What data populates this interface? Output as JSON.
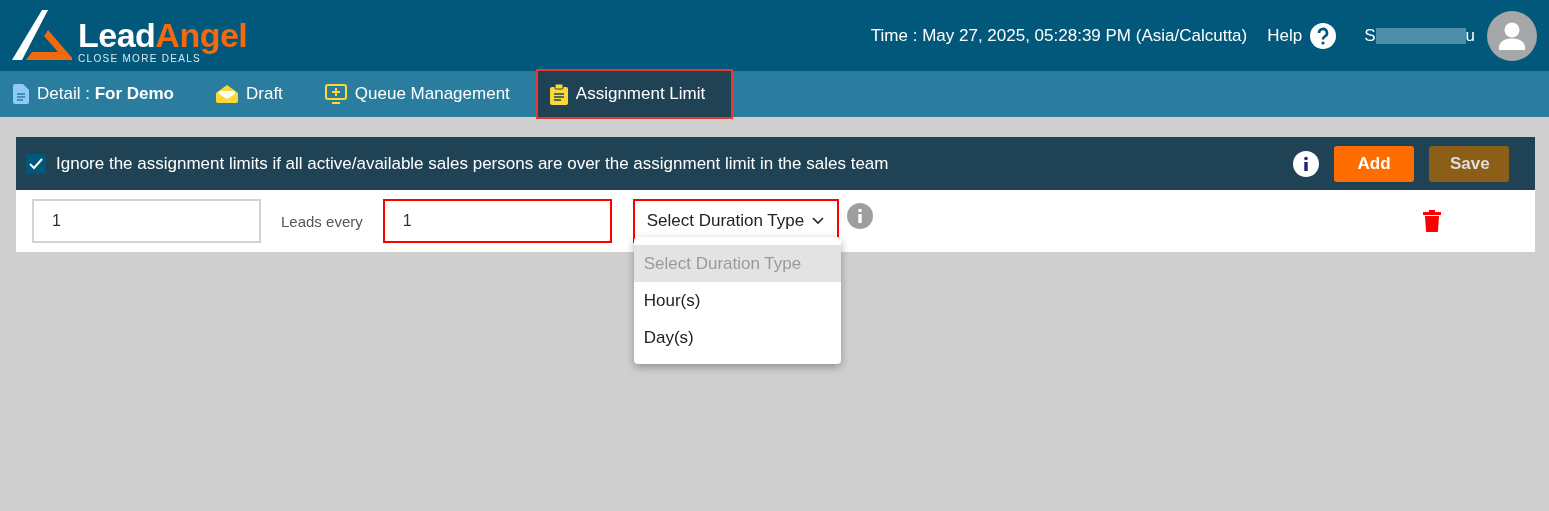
{
  "logo": {
    "part_1": "Lead",
    "part_2": "Angel",
    "tagline": "CLOSE MORE DEALS"
  },
  "header": {
    "time": "Time : May 27, 2025, 05:28:39 PM (Asia/Calcutta)",
    "help": "Help",
    "user_start": "S",
    "user_end": "u"
  },
  "tabs": [
    {
      "label": "Detail : **For Demo**",
      "selected": false
    },
    {
      "label": "Draft",
      "selected": false
    },
    {
      "label": "Queue Management",
      "selected": false
    },
    {
      "label": "Assignment Limit",
      "selected": true
    }
  ],
  "options_bar": {
    "checked": true,
    "text": "Ignore the assignment limits if all active/available sales persons are over the assignment limit in the sales team",
    "buttons": [
      {
        "label": "Add",
        "kind": "primary"
      },
      {
        "label": "Save",
        "kind": "secondary"
      }
    ]
  },
  "limit_row": {
    "count": {
      "value": "1",
      "invalid": false
    },
    "label": "Leads every",
    "period": {
      "value": "1",
      "invalid": true
    },
    "duration": {
      "value": "Select Duration Type",
      "invalid": true,
      "expanded": true
    }
  },
  "duration_options": [
    {
      "label": "Select Duration Type",
      "selected": true,
      "disabled": true
    },
    {
      "label": "Hour(s)",
      "selected": false,
      "disabled": false
    },
    {
      "label": "Day(s)",
      "selected": false,
      "disabled": false
    }
  ]
}
